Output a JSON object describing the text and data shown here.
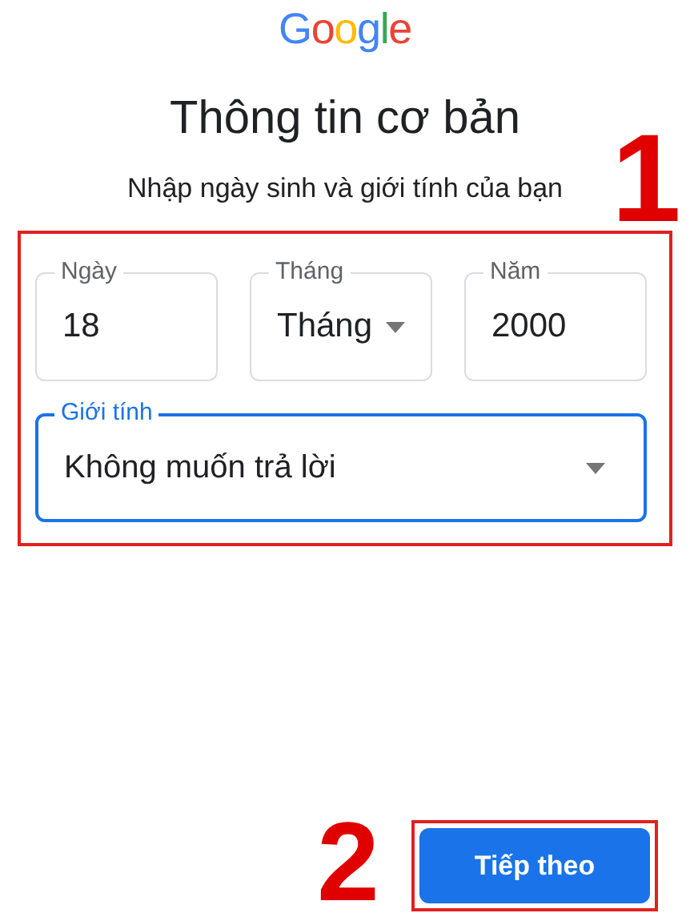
{
  "logo": "Google",
  "title": "Thông tin cơ bản",
  "subtitle": "Nhập ngày sinh và giới tính của bạn",
  "date_fields": [
    {
      "label": "Ngày",
      "value": "18",
      "kind": "text",
      "focused": false
    },
    {
      "label": "Tháng",
      "value": "Tháng",
      "kind": "select",
      "focused": false
    },
    {
      "label": "Năm",
      "value": "2000",
      "kind": "text",
      "focused": false
    }
  ],
  "gender_field": {
    "label": "Giới tính",
    "value": "Không muốn trả lời",
    "kind": "select",
    "focused": true
  },
  "next_button": "Tiếp theo",
  "annotations": [
    "1",
    "2"
  ]
}
